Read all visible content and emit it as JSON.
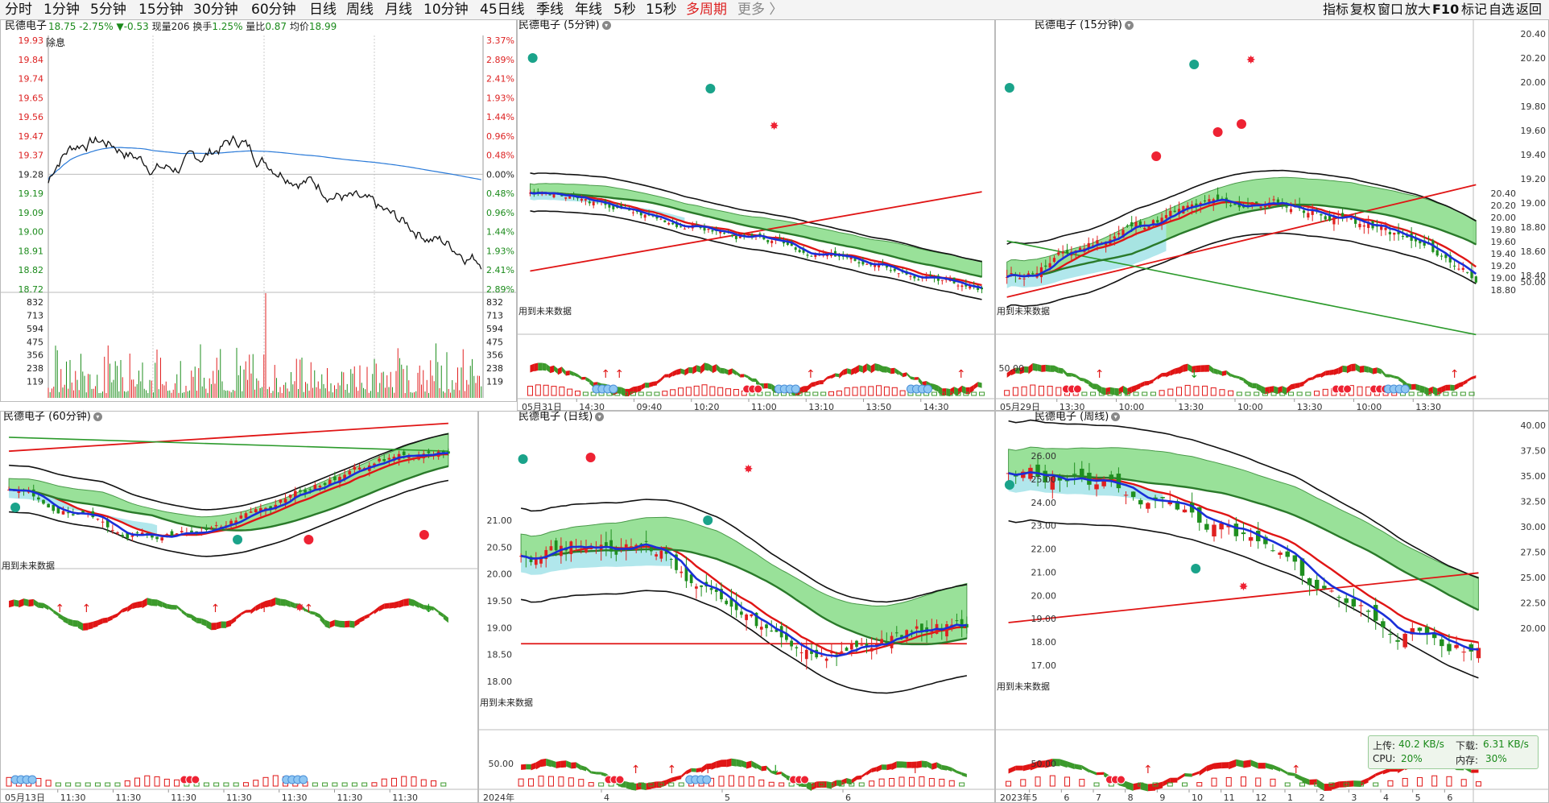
{
  "topbar": {
    "tabs": [
      "分时",
      "1分钟",
      "5分钟",
      "15分钟",
      "30分钟",
      "60分钟",
      "日线",
      "周线",
      "月线",
      "10分钟",
      "45日线",
      "季线",
      "年线",
      "5秒",
      "15秒",
      "多周期",
      "更多 〉"
    ],
    "right": [
      "指标",
      "复权",
      "窗口",
      "放大",
      "F10",
      "标记",
      "自选",
      "返回"
    ]
  },
  "stock_name": "民德电子",
  "intraday": {
    "price": "18.75",
    "pct": "-2.75%",
    "change": "▼-0.53",
    "volume_label": "现量",
    "volume": "206",
    "turnover_label": "换手",
    "turnover": "1.25%",
    "ratio_label": "量比",
    "ratio": "0.87",
    "avg_label": "均价",
    "avg": "18.99",
    "ex_label": "除息",
    "price_ticks": [
      "19.93",
      "19.84",
      "19.74",
      "19.65",
      "19.56",
      "19.47",
      "19.37",
      "19.28",
      "19.19",
      "19.09",
      "19.00",
      "18.91",
      "18.82",
      "18.72"
    ],
    "pct_ticks": [
      "3.37%",
      "2.89%",
      "2.41%",
      "1.93%",
      "1.44%",
      "0.96%",
      "0.48%",
      "0.00%",
      "0.48%",
      "0.96%",
      "1.44%",
      "1.93%",
      "2.41%",
      "2.89%"
    ],
    "vol_ticks": [
      "832",
      "713",
      "594",
      "475",
      "356",
      "238",
      "119"
    ]
  },
  "panels": {
    "p5": {
      "title": "民德电子 (5分钟)",
      "y_ticks": [],
      "sub_tick": "",
      "xlabels": [
        "05月31日",
        "14:30",
        "09:40",
        "10:20",
        "11:00",
        "13:10",
        "13:50",
        "14:30"
      ]
    },
    "p15": {
      "title": "民德电子 (15分钟)",
      "y_ticks": [
        "20.40",
        "20.20",
        "20.00",
        "19.80",
        "19.60",
        "19.40",
        "19.20",
        "19.00",
        "18.80"
      ],
      "sub_tick": "50.00",
      "xlabels": [
        "05月29日",
        "13:30",
        "10:00",
        "13:30",
        "10:00",
        "13:30",
        "10:00",
        "13:30"
      ]
    },
    "p60": {
      "title": "民德电子 (60分钟)",
      "y_ticks": [],
      "sub_tick": "",
      "xlabels": [
        "05月13日",
        "11:30",
        "11:30",
        "11:30",
        "11:30",
        "11:30",
        "11:30",
        "11:30"
      ]
    },
    "pday": {
      "title": "民德电子 (日线)",
      "y_ticks": [
        "21.00",
        "20.50",
        "20.00",
        "19.50",
        "19.00",
        "18.50",
        "18.00"
      ],
      "sub_tick": "50.00",
      "xlabels": [
        "2024年",
        "4",
        "5",
        "6"
      ]
    },
    "pweek": {
      "title": "民德电子 (周线)",
      "y_ticks": [
        "26.00",
        "25.00",
        "24.00",
        "23.00",
        "22.00",
        "21.00",
        "20.00",
        "19.00",
        "18.00",
        "17.00"
      ],
      "sub_tick": "50.00",
      "xlabels": [
        "2023年",
        "5",
        "6",
        "7",
        "8",
        "9",
        "10",
        "11",
        "12",
        "1",
        "2",
        "3",
        "4",
        "5",
        "6"
      ]
    }
  },
  "far_right_axis": {
    "top": [
      "20.40",
      "20.20",
      "20.00",
      "19.80",
      "19.60",
      "19.40",
      "19.20",
      "19.00",
      "18.80",
      "18.60",
      "18.40",
      "50.00"
    ],
    "bottom": [
      "40.00",
      "37.50",
      "35.00",
      "32.50",
      "30.00",
      "27.50",
      "25.00",
      "22.50",
      "20.00"
    ]
  },
  "future_note": "用到未来数据",
  "network": {
    "up_label": "上传:",
    "up": "40.2 KB/s",
    "down_label": "下载:",
    "down": "6.31 KB/s",
    "cpu_label": "CPU:",
    "cpu": "20%",
    "mem_label": "内存:",
    "mem": "30%"
  },
  "colors": {
    "up": "#e02020",
    "down": "#1f8f1f",
    "ma_blue": "#1a2fd8",
    "band_green": "#7fd97f",
    "band_cyan": "#a8e4ea"
  }
}
